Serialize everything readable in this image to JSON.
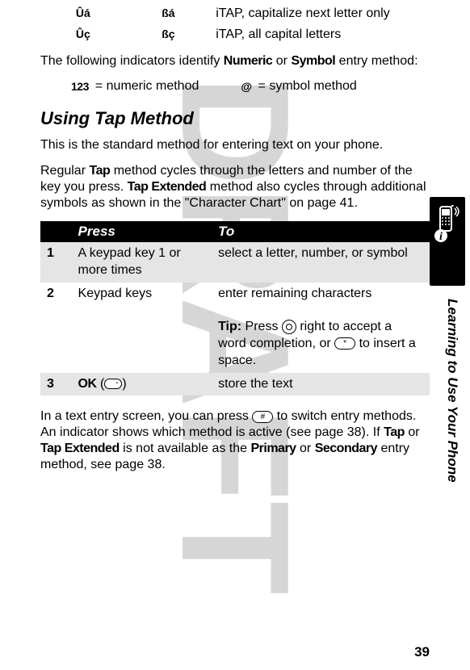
{
  "top_rows": [
    {
      "icon1": "Ûá",
      "icon2": "ßá",
      "desc": "iTAP, capitalize next letter only"
    },
    {
      "icon1": "Ûç",
      "icon2": "ßç",
      "desc": "iTAP, all capital letters"
    }
  ],
  "intro": {
    "line1a": "The following indicators identify ",
    "numeric": "Numeric",
    "line1b": " or ",
    "symbol": "Symbol",
    "line1c": " entry method:"
  },
  "indicators": {
    "i1_icon": "123",
    "i1_text": "= numeric method",
    "i2_icon": "@",
    "i2_text": "= symbol method"
  },
  "section_heading": "Using Tap Method",
  "p2": "This is the standard method for entering text on your phone.",
  "p3": {
    "a": "Regular ",
    "tap": "Tap",
    "b": " method cycles through the letters and number of the key you press. ",
    "tapext": "Tap Extended",
    "c": " method also cycles through additional symbols as shown in the \"Character Chart\" on page 41."
  },
  "table": {
    "h_press": "Press",
    "h_to": "To",
    "rows": [
      {
        "num": "1",
        "press": "A keypad key 1 or more times",
        "to": "select a letter, number, or symbol",
        "tip": null,
        "shaded": true
      },
      {
        "num": "2",
        "press": "Keypad keys",
        "to": "enter remaining characters",
        "tip": {
          "label": "Tip:",
          "a": " Press ",
          "b": " right to accept a word completion, or ",
          "c": " to insert a space."
        },
        "shaded": false
      },
      {
        "num": "3",
        "press_label": "OK",
        "to": "store the text",
        "tip": null,
        "shaded": true,
        "softkey": true
      }
    ]
  },
  "p4": {
    "a": "In a text entry screen, you can press ",
    "hashkey": "#",
    "b": " to switch entry methods. An indicator shows which method is active (see page 38). If ",
    "tap": "Tap",
    "c": " or ",
    "tapext": "Tap Extended",
    "d": " is not available as the ",
    "primary": "Primary",
    "e": " or ",
    "secondary": "Secondary",
    "f": " entry method, see page 38."
  },
  "vertical": "Learning to Use Your Phone",
  "page_num": "39",
  "draft": "DRAFT"
}
